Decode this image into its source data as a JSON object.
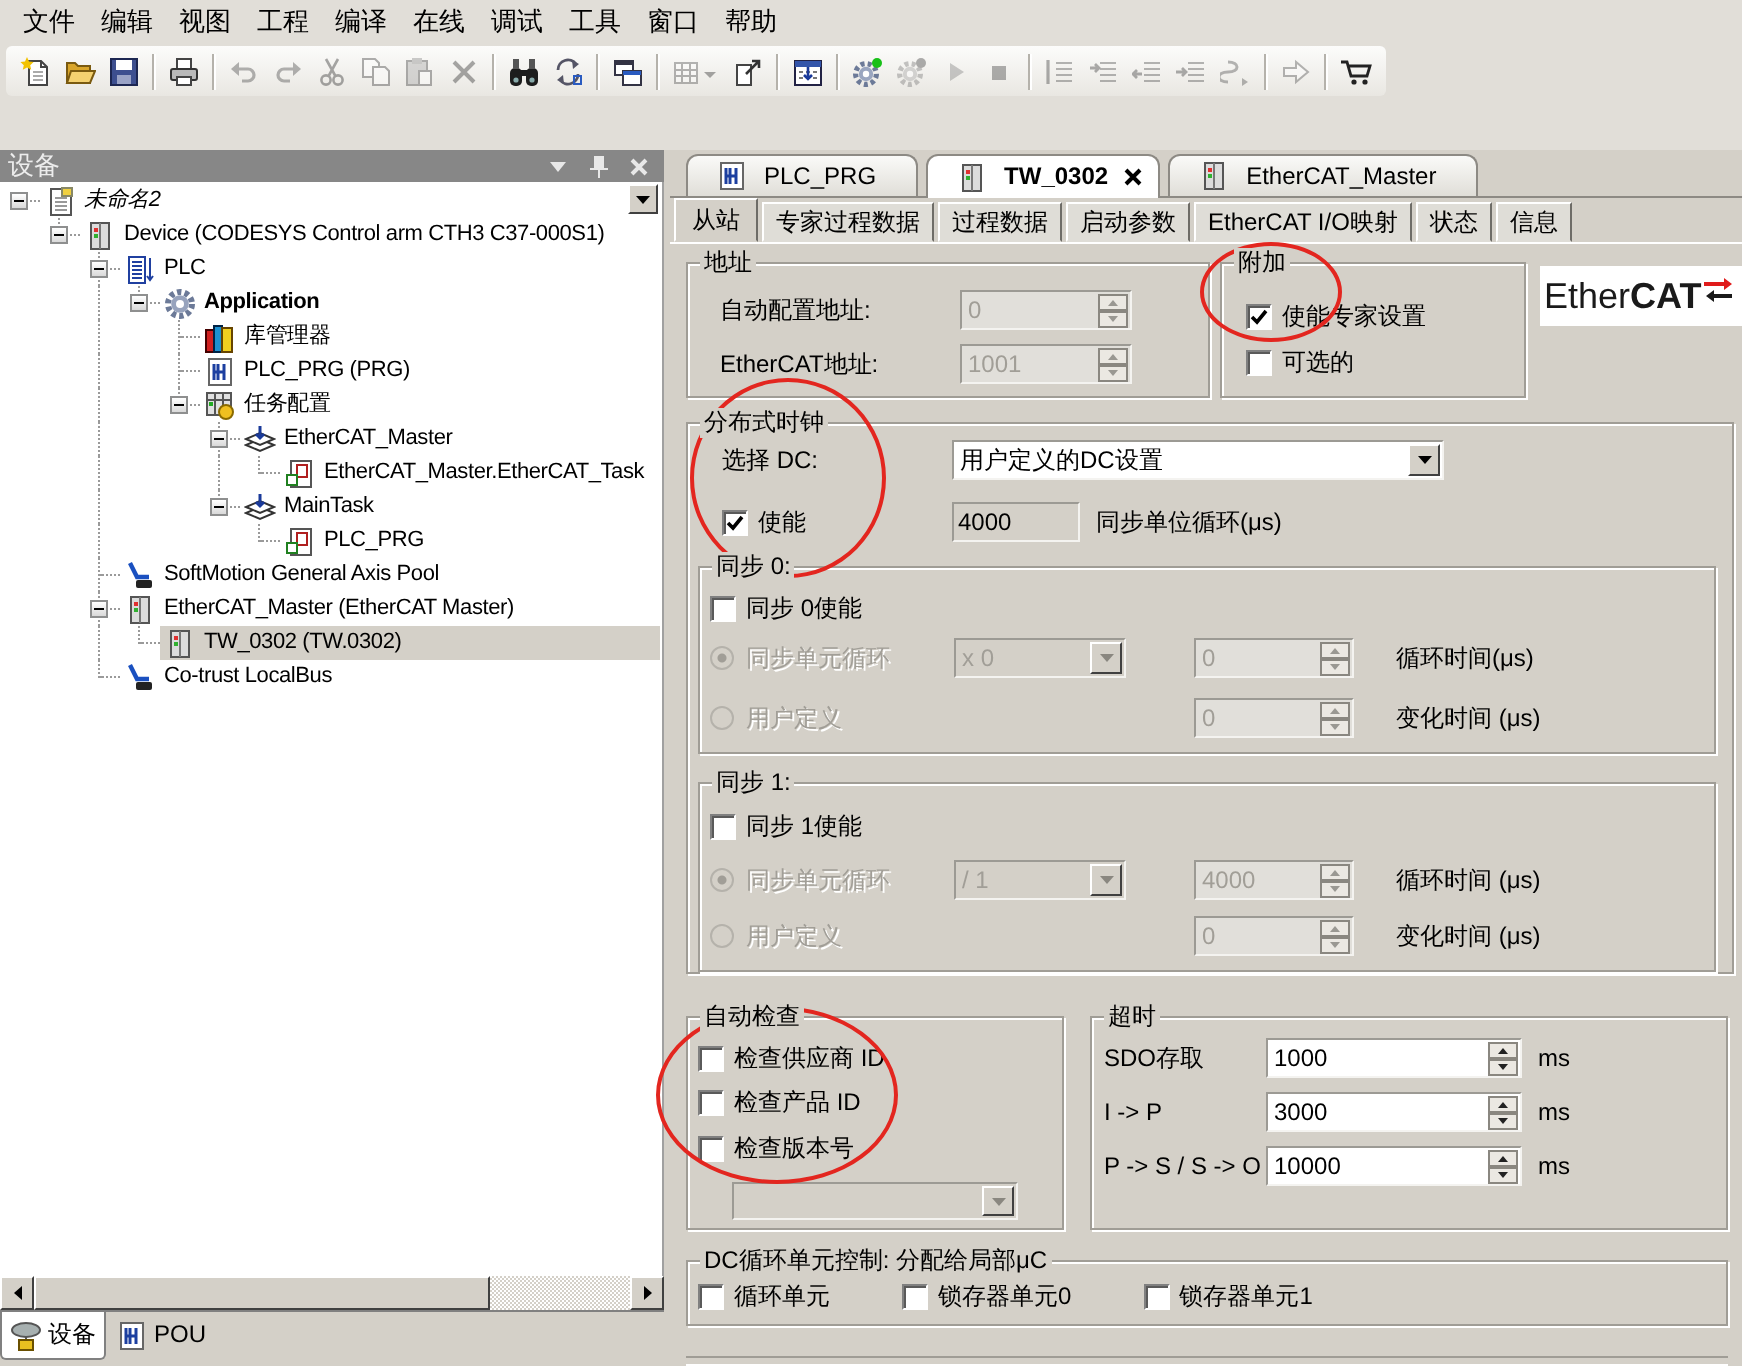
{
  "menu": [
    "文件",
    "编辑",
    "视图",
    "工程",
    "编译",
    "在线",
    "调试",
    "工具",
    "窗口",
    "帮助"
  ],
  "toolbar": [
    [
      {
        "kind": "new",
        "disabled": false
      },
      {
        "kind": "open",
        "disabled": false
      },
      {
        "kind": "save",
        "disabled": false
      }
    ],
    [
      {
        "kind": "print",
        "disabled": false
      }
    ],
    [
      {
        "kind": "undo",
        "disabled": true
      },
      {
        "kind": "redo",
        "disabled": true
      },
      {
        "kind": "cut",
        "disabled": true
      },
      {
        "kind": "copy",
        "disabled": true
      },
      {
        "kind": "paste",
        "disabled": true
      },
      {
        "kind": "delete",
        "disabled": true
      }
    ],
    [
      {
        "kind": "find",
        "disabled": false
      },
      {
        "kind": "replace",
        "disabled": false
      }
    ],
    [
      {
        "kind": "windows",
        "disabled": false
      }
    ],
    [
      {
        "kind": "grid_menu",
        "disabled": true
      },
      {
        "kind": "page",
        "disabled": false
      }
    ],
    [
      {
        "kind": "build",
        "disabled": false
      }
    ],
    [
      {
        "kind": "login",
        "disabled": false
      },
      {
        "kind": "logout",
        "disabled": true
      },
      {
        "kind": "run",
        "disabled": true
      },
      {
        "kind": "stop",
        "disabled": true
      }
    ],
    [
      {
        "kind": "step_over",
        "disabled": true
      },
      {
        "kind": "step_into",
        "disabled": true
      },
      {
        "kind": "step_out",
        "disabled": true
      },
      {
        "kind": "cursor",
        "disabled": true
      },
      {
        "kind": "set_next",
        "disabled": true
      }
    ],
    [
      {
        "kind": "goto",
        "disabled": true
      }
    ],
    [
      {
        "kind": "cart",
        "disabled": false
      }
    ]
  ],
  "devices": {
    "title": "设备",
    "tree": [
      {
        "label": "未命名2",
        "kind": "project",
        "selected": false,
        "expanded": true,
        "children": [
          {
            "label": "Device (CODESYS Control arm CTH3 C37-000S1)",
            "kind": "device",
            "selected": false,
            "expanded": true,
            "children": [
              {
                "label": "PLC",
                "kind": "plc",
                "selected": false,
                "expanded": true,
                "children": [
                  {
                    "label": "Application",
                    "kind": "application",
                    "selected": false,
                    "expanded": true,
                    "children": [
                      {
                        "label": "库管理器",
                        "kind": "library",
                        "selected": false
                      },
                      {
                        "label": "PLC_PRG (PRG)",
                        "kind": "pou",
                        "selected": false
                      },
                      {
                        "label": "任务配置",
                        "kind": "task_config",
                        "selected": false,
                        "expanded": true,
                        "children": [
                          {
                            "label": "EtherCAT_Master",
                            "kind": "task",
                            "selected": false,
                            "expanded": true,
                            "children": [
                              {
                                "label": "EtherCAT_Master.EtherCAT_Task",
                                "kind": "task_call",
                                "selected": false
                              }
                            ]
                          },
                          {
                            "label": "MainTask",
                            "kind": "task",
                            "selected": false,
                            "expanded": true,
                            "children": [
                              {
                                "label": "PLC_PRG",
                                "kind": "task_call",
                                "selected": false
                              }
                            ]
                          }
                        ]
                      }
                    ]
                  }
                ]
              },
              {
                "label": "SoftMotion General Axis Pool",
                "kind": "module",
                "selected": false
              },
              {
                "label": "EtherCAT_Master (EtherCAT Master)",
                "kind": "device",
                "selected": false,
                "expanded": true,
                "children": [
                  {
                    "label": "TW_0302 (TW.0302)",
                    "kind": "device",
                    "selected": true
                  }
                ]
              },
              {
                "label": "Co-trust LocalBus",
                "kind": "module",
                "selected": false
              }
            ]
          }
        ]
      }
    ],
    "bottom_tabs": [
      {
        "label": "设备",
        "kind": "devices",
        "selected": true
      },
      {
        "label": "POU",
        "kind": "pou",
        "selected": false
      }
    ]
  },
  "editor_tabs": [
    {
      "label": "PLC_PRG",
      "kind": "pou",
      "selected": false
    },
    {
      "label": "TW_0302",
      "kind": "device",
      "selected": true
    },
    {
      "label": "EtherCAT_Master",
      "kind": "device",
      "selected": false
    }
  ],
  "page_tabs": [
    {
      "label": "从站",
      "selected": true
    },
    {
      "label": "专家过程数据",
      "selected": false
    },
    {
      "label": "过程数据",
      "selected": false
    },
    {
      "label": "启动参数",
      "selected": false
    },
    {
      "label": "EtherCAT I/O映射",
      "selected": false
    },
    {
      "label": "状态",
      "selected": false
    },
    {
      "label": "信息",
      "selected": false
    }
  ],
  "address": {
    "title": "地址",
    "fields": [
      {
        "label": "自动配置地址:",
        "value": "0",
        "disabled": true
      },
      {
        "label": "EtherCAT地址:",
        "value": "1001",
        "disabled": true
      }
    ]
  },
  "additional": {
    "title": "附加",
    "circled": true,
    "options": [
      {
        "label": "使能专家设置",
        "checked": true
      },
      {
        "label": "可选的",
        "checked": false
      }
    ]
  },
  "logo": {
    "text": "Ether**CAT**"
  },
  "distributed_clock": {
    "title": "分布式时钟",
    "circled": true,
    "select": {
      "label": "选择 DC:",
      "value": "用户定义的DC设置"
    },
    "enable": {
      "label": "使能",
      "checked": true
    },
    "cycle": {
      "value": "4000",
      "unit": "同步单位循环(μs)"
    },
    "sync_units": [
      {
        "title": "同步 0:",
        "enable": {
          "label": "同步 0使能",
          "checked": false
        },
        "modes": [
          {
            "kind": "cycle",
            "label": "同步单元循环",
            "selected": true,
            "disabled": true,
            "dropdown": "x 0",
            "value": "0",
            "unit": "循环时间(μs)"
          },
          {
            "kind": "user",
            "label": "用户定义",
            "selected": false,
            "disabled": true,
            "value": "0",
            "unit": "变化时间 (μs)"
          }
        ]
      },
      {
        "title": "同步 1:",
        "enable": {
          "label": "同步 1使能",
          "checked": false
        },
        "modes": [
          {
            "kind": "cycle",
            "label": "同步单元循环",
            "selected": true,
            "disabled": true,
            "dropdown": "/ 1",
            "value": "4000",
            "unit": "循环时间 (μs)"
          },
          {
            "kind": "user",
            "label": "用户定义",
            "selected": false,
            "disabled": true,
            "value": "0",
            "unit": "变化时间 (μs)"
          }
        ]
      }
    ]
  },
  "auto_check": {
    "title": "自动检查",
    "circled": true,
    "options": [
      {
        "label": "检查供应商 ID",
        "checked": false
      },
      {
        "label": "检查产品 ID",
        "checked": false
      },
      {
        "label": "检查版本号",
        "checked": false
      }
    ],
    "version_select": {
      "disabled": true
    }
  },
  "timeouts": {
    "title": "超时",
    "rows": [
      {
        "label": "SDO存取",
        "value": "1000",
        "unit": "ms"
      },
      {
        "label": "I -> P",
        "value": "3000",
        "unit": "ms"
      },
      {
        "label": "P -> S / S -> O",
        "value": "10000",
        "unit": "ms"
      }
    ]
  },
  "dc_cycle_control": {
    "title": "DC循环单元控制: 分配给局部μC",
    "options": [
      {
        "label": "循环单元",
        "checked": false
      },
      {
        "label": "锁存器单元0",
        "checked": false
      },
      {
        "label": "锁存器单元1",
        "checked": false
      }
    ]
  }
}
